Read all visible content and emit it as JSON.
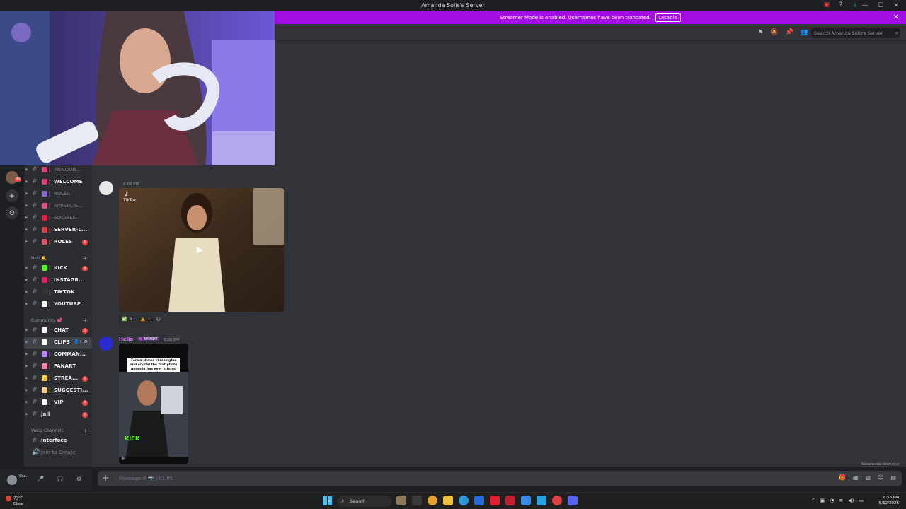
{
  "window": {
    "title": "Amanda Solis's Server"
  },
  "banner": {
    "text": "Streamer Mode is enabled. Usernames have been truncated.",
    "button": "Disable"
  },
  "header": {
    "search_placeholder": "Search Amanda Solis's Server"
  },
  "sidebar": {
    "channels": [
      {
        "name": "ANNOUN...",
        "muted": true,
        "color": "#e0407a"
      },
      {
        "name": "WELCOME",
        "muted": false,
        "color": "#e0407a"
      },
      {
        "name": "RULES",
        "muted": true,
        "color": "#8a6ad0"
      },
      {
        "name": "APPEAL-S...",
        "muted": true,
        "color": "#e05080"
      },
      {
        "name": "SOCIALS",
        "muted": true,
        "color": "#e02040"
      },
      {
        "name": "SERVER-L...",
        "muted": false,
        "color": "#e04040"
      },
      {
        "name": "ROLES",
        "muted": false,
        "color": "#e05060",
        "badge": "1"
      }
    ],
    "category_noti": "Noti 🔔",
    "channels2": [
      {
        "name": "KICK",
        "muted": false,
        "color": "#53fc18",
        "badge": "9"
      },
      {
        "name": "INSTAGR...",
        "muted": false,
        "color": "#e02060"
      },
      {
        "name": "TIKTOK",
        "muted": false,
        "color": "#333333"
      },
      {
        "name": "YOUTUBE",
        "muted": false,
        "color": "#ffffff"
      }
    ],
    "category_community": "Community 💕",
    "channels3": [
      {
        "name": "CHAT",
        "muted": false,
        "color": "#ffffff",
        "badge": "1"
      },
      {
        "name": "CLIPS",
        "muted": false,
        "color": "#ffffff",
        "selected": true
      },
      {
        "name": "COMMAN...",
        "muted": false,
        "color": "#c080ff"
      },
      {
        "name": "FANART",
        "muted": false,
        "color": "#ff80a0"
      },
      {
        "name": "STREA...",
        "muted": false,
        "color": "#ffd040",
        "badge": "6"
      },
      {
        "name": "SUGGESTI...",
        "muted": false,
        "color": "#ffd080"
      },
      {
        "name": "VIP",
        "muted": false,
        "color": "#ffffff",
        "badge": "7"
      },
      {
        "name": "jail",
        "muted": false,
        "color": "",
        "badge": "1"
      }
    ],
    "category_voice": "Voice Channels",
    "voice": [
      {
        "name": "interface"
      },
      {
        "name": "Join to Create"
      }
    ]
  },
  "messages": [
    {
      "author": "",
      "time": "8:08 PM",
      "embed_label": "TikTok",
      "reactions": [
        {
          "emoji": "✅",
          "count": "6"
        },
        {
          "emoji": "🙇",
          "count": "1"
        }
      ]
    },
    {
      "author": "Hello",
      "role": "💜 WINDY",
      "time": "8:08 PM",
      "video_caption": "Zerala shows chrazingfee and crystal the first photo Amanda has ever printed out... 😭💀",
      "video_tag": "KICK"
    }
  ],
  "footer": {
    "slowmode": "Slowmode Immune",
    "composer_placeholder": "Message # 📷 | CLIPS"
  },
  "user_panel": {
    "name": "Stu..."
  },
  "taskbar": {
    "weather_temp": "73°F",
    "weather_desc": "Clear",
    "search": "Search",
    "time": "8:53 PM",
    "date": "5/12/2026"
  }
}
